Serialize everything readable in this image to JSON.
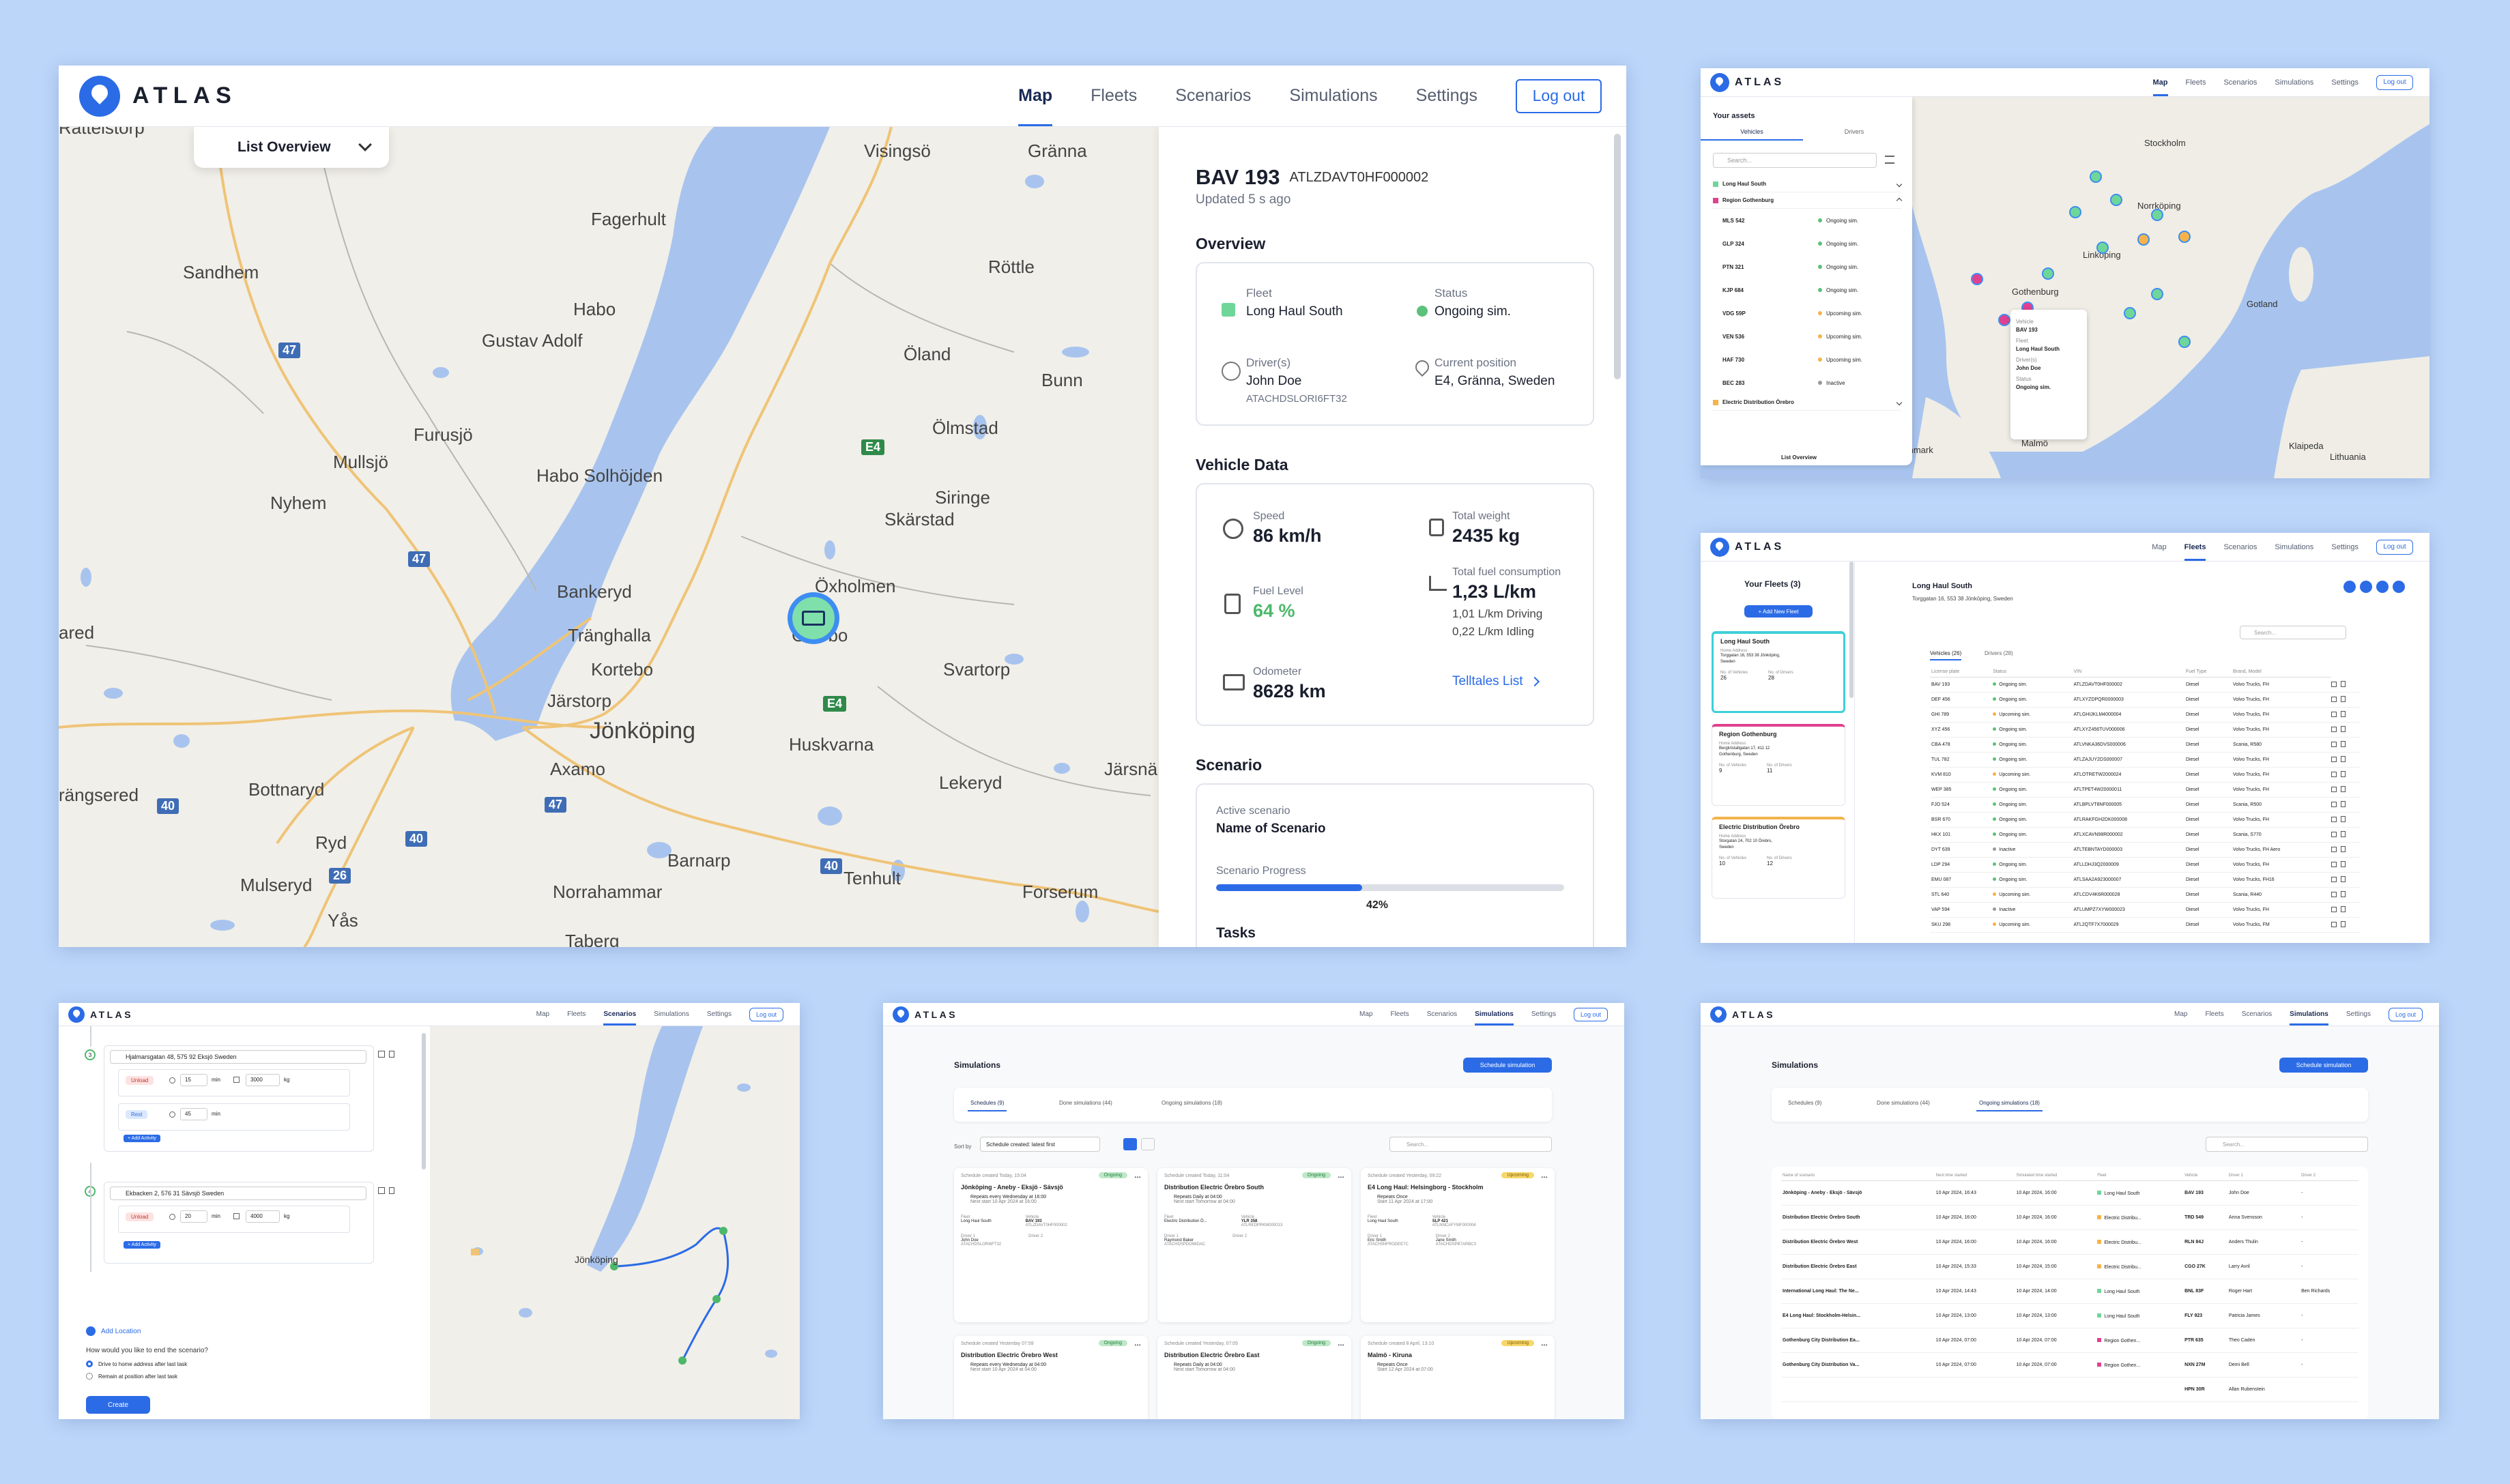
{
  "brand": "ATLAS",
  "nav": {
    "map": "Map",
    "fleets": "Fleets",
    "scenarios": "Scenarios",
    "simulations": "Simulations",
    "settings": "Settings",
    "logout": "Log out"
  },
  "colors": {
    "accent": "#2b6be6",
    "fleet_green": "#6fd69a",
    "fleet_pink": "#e0418f",
    "fleet_orange": "#f5b34a"
  },
  "main": {
    "list_overview": "List Overview",
    "places": [
      "Visingsö",
      "Gränna",
      "Fagerhult",
      "Röttle",
      "Sandhem",
      "Habo",
      "Gustav Adolf",
      "Öland",
      "Bunn",
      "Furusjö",
      "Ölmstad",
      "Mullsjö",
      "Habo Solhöjden",
      "Siringe",
      "Nyhem",
      "Skärstad",
      "Bankeryd",
      "Öxholmen",
      "Tränghalla",
      "Gisebo",
      "Kortebo",
      "Svartorp",
      "Järstorp",
      "Jönköping",
      "Huskvarna",
      "Axamo",
      "Lekeryd",
      "rängsered",
      "Bottnaryd",
      "Järsnä",
      "Ryd",
      "Mulseryd",
      "Barnarp",
      "Tenhult",
      "Norrahammar",
      "Forserum",
      "Yås",
      "Taberg",
      "Rattelstorp",
      "ared"
    ],
    "roads": [
      "47",
      "E4",
      "47",
      "E4",
      "40",
      "47",
      "40",
      "26",
      "40"
    ],
    "vehicle": {
      "title": "BAV 193",
      "vin": "ATLZDAVT0HF000002",
      "updated": "Updated 5 s ago"
    },
    "overview": {
      "heading": "Overview",
      "fleet_label": "Fleet",
      "fleet": "Long Haul South",
      "status_label": "Status",
      "status": "Ongoing sim.",
      "driver_label": "Driver(s)",
      "driver": "John Doe",
      "driver_id": "ATACHDSLORI6FT32",
      "pos_label": "Current position",
      "pos": "E4, Gränna, Sweden"
    },
    "vdata": {
      "heading": "Vehicle Data",
      "speed_label": "Speed",
      "speed": "86 km/h",
      "weight_label": "Total weight",
      "weight": "2435 kg",
      "fuel_label": "Fuel Level",
      "fuel": "64 %",
      "cons_label": "Total fuel consumption",
      "cons": "1,23 L/km",
      "cons_drive": "1,01 L/km Driving",
      "cons_idle": "0,22 L/km Idling",
      "odo_label": "Odometer",
      "odo": "8628 km",
      "telltales": "Telltales List"
    },
    "scenario": {
      "heading": "Scenario",
      "active_label": "Active scenario",
      "active": "Name of Scenario",
      "progress_label": "Scenario Progress",
      "progress": 0.42,
      "progress_text": "42%",
      "tasks": "Tasks"
    }
  },
  "assets": {
    "title": "Your assets",
    "tab_v": "Vehicles",
    "tab_d": "Drivers",
    "search": "Search...",
    "groups": [
      "Long Haul South",
      "Region Gothenburg",
      "Electric Distribution Örebro"
    ],
    "rows": [
      [
        "MLS 542",
        "Ongoing sim."
      ],
      [
        "GLP 324",
        "Ongoing sim."
      ],
      [
        "PTN 321",
        "Ongoing sim."
      ],
      [
        "KJP 684",
        "Ongoing sim."
      ],
      [
        "VDG 59P",
        "Upcoming sim."
      ],
      [
        "VEN 536",
        "Upcoming sim."
      ],
      [
        "HAF 730",
        "Upcoming sim."
      ],
      [
        "BEC 283",
        "Inactive"
      ]
    ],
    "popup": [
      "Vehicle",
      "BAV 193",
      "Fleet",
      "Long Haul South",
      "Driver(s)",
      "John Doe",
      "Status",
      "Ongoing sim."
    ],
    "map_places": [
      "Stockholm",
      "Norrköping",
      "Linköping",
      "Gothenburg",
      "Malmö",
      "Denmark",
      "Klaipeda",
      "Lithuania",
      "Gotland"
    ],
    "list_overview": "List Overview"
  },
  "fleets": {
    "title": "Your Fleets (3)",
    "add": "+ Add New Fleet",
    "cards": [
      {
        "name": "Long Haul South",
        "lbl": "Home Address",
        "addr": "Torggatan 16, 553 38 Jönköping, Sweden",
        "nv": "26",
        "nd": "28"
      },
      {
        "name": "Region Gothenburg",
        "lbl": "Home Address",
        "addr": "Bergkristallgatan 17, 411 12 Gothenburg, Sweden",
        "nv": "9",
        "nd": "11"
      },
      {
        "name": "Electric Distribution Örebro",
        "lbl": "Home Address",
        "addr": "Storgatan 24, 702 10 Örebro, Sweden",
        "nv": "10",
        "nd": "12"
      }
    ],
    "lbl_nv": "No. of Vehicles",
    "lbl_nd": "No. of Drivers",
    "detail_title": "Long Haul South",
    "detail_addr": "Torggatan 16, 553 38 Jönköping, Sweden",
    "tab_v": "Vehicles (26)",
    "tab_d": "Drivers (28)",
    "search": "Search...",
    "cols": [
      "License plate",
      "Status",
      "VIN",
      "Fuel Type",
      "Brand, Model"
    ],
    "rows": [
      [
        "BAV 193",
        "Ongoing sim.",
        "ATLZDAVT0HF000002",
        "Diesel",
        "Volvo Trucks, FH"
      ],
      [
        "DEF 456",
        "Ongoing sim.",
        "ATLXYZDPQR0000003",
        "Diesel",
        "Volvo Trucks, FH"
      ],
      [
        "GHI 789",
        "Upcoming sim.",
        "ATLGHIJKLM4000004",
        "Diesel",
        "Volvo Trucks, FH"
      ],
      [
        "XYZ 456",
        "Ongoing sim.",
        "ATLXYZ456TUV000006",
        "Diesel",
        "Volvo Trucks, FH"
      ],
      [
        "CBA 478",
        "Ongoing sim.",
        "ATLVNKA36DVS000006",
        "Diesel",
        "Scania, R580"
      ],
      [
        "TUL 782",
        "Ongoing sim.",
        "ATLZAJUY2DS000007",
        "Diesel",
        "Volvo Trucks, FH"
      ],
      [
        "KVM 810",
        "Upcoming sim.",
        "ATLOTRETW2000024",
        "Diesel",
        "Volvo Trucks, FH"
      ],
      [
        "WEP 385",
        "Ongoing sim.",
        "ATLTPET4W20000011",
        "Diesel",
        "Volvo Trucks, FH"
      ],
      [
        "FJO 524",
        "Ongoing sim.",
        "ATLBPLVT8NF000005",
        "Diesel",
        "Scania, R500"
      ],
      [
        "BSR 670",
        "Ongoing sim.",
        "ATLRAKFGH2DK000008",
        "Diesel",
        "Volvo Trucks, FH"
      ],
      [
        "HKX 101",
        "Ongoing sim.",
        "ATLXCAVN98R000002",
        "Diesel",
        "Scania, S770"
      ],
      [
        "DYT 639",
        "Inactive",
        "ATLTEBNTAYD000003",
        "Diesel",
        "Volvo Trucks, FH Aero"
      ],
      [
        "LDP 294",
        "Ongoing sim.",
        "ATLLDHJ3Q2000009",
        "Diesel",
        "Volvo Trucks, FH"
      ],
      [
        "EMU 087",
        "Ongoing sim.",
        "ATLSAA2A923000007",
        "Diesel",
        "Volvo Trucks, FH16"
      ],
      [
        "STL 640",
        "Upcoming sim.",
        "ATLCDV4K6R000028",
        "Diesel",
        "Scania, R440"
      ],
      [
        "VAP 594",
        "Inactive",
        "ATLUMPZ7XYW000023",
        "Diesel",
        "Volvo Trucks, FH"
      ],
      [
        "SKU 298",
        "Upcoming sim.",
        "ATL2QTF7X7000029",
        "Diesel",
        "Volvo Trucks, FM"
      ]
    ]
  },
  "scen": {
    "stops": [
      {
        "n": "3",
        "addr": "Hjalmarsgatan 48, 575 92 Eksjö Sweden",
        "a1": "Unload",
        "t1": "15",
        "k1": "3000",
        "a2": "Rest",
        "t2": "45"
      },
      {
        "n": "4",
        "addr": "Ekbacken 2, 576 31 Sävsjö Sweden",
        "a1": "Unload",
        "t1": "20",
        "k1": "4000"
      }
    ],
    "min": "min",
    "kg": "kg",
    "add_activity": "+ Add Activity",
    "add_location": "Add Location",
    "question": "How would you like to end the scenario?",
    "opt1": "Drive to home address after last task",
    "opt2": "Remain at position after last task",
    "create": "Create",
    "map_label": "Jönköping"
  },
  "sims1": {
    "title": "Simulations",
    "schedule": "Schedule simulation",
    "tabs": [
      "Schedules (9)",
      "Done simulations (44)",
      "Ongoing simulations (18)"
    ],
    "sort_label": "Sort by",
    "sort": "Schedule created: latest first",
    "search": "Search...",
    "cards": [
      {
        "created": "Schedule created Today, 15:04",
        "badge": "Ongoing",
        "title": "Jönköping - Aneby - Eksjö - Sävsjö",
        "repeat": "Repeats every Wednesday at 16:00",
        "next": "Next start 10 Apr 2024 at 16:00",
        "fleet": "Long Haul South",
        "vehicle": "BAV 193",
        "vin": "ATLZDAVT0HF000002",
        "driver": "John Doe",
        "did": "ATACHDSLORI6FT32"
      },
      {
        "created": "Schedule created Today, 11:04",
        "badge": "Ongoing",
        "title": "Distribution Electric Örebro South",
        "repeat": "Repeats Daily at 04:00",
        "next": "Next start Tomorrow at 04:00",
        "fleet": "Electric Distribution Ö...",
        "vehicle": "YLR 358",
        "vin": "ATLREDPRKM000013",
        "driver": "Raymond Baker",
        "did": "ATACHDSPDO98DAC"
      },
      {
        "created": "Schedule created Yesterday, 09:22",
        "badge": "Upcoming",
        "title": "E4 Long Haul: Helsingborg - Stockholm",
        "repeat": "Repeats Once",
        "next": "Start 11 Apr 2024 at 17:00",
        "fleet": "Long Haul South",
        "vehicle": "SLP 421",
        "vin": "ATLNNCAFYMF000004",
        "driver": "Eric Smith",
        "did": "ATACH5NFRODEE7C",
        "driver2": "Jane Smith",
        "did2": "ATACHDSPB7ARBC3"
      },
      {
        "created": "Schedule created Yesterday 07:59",
        "badge": "Ongoing",
        "title": "Distribution Electric Örebro West",
        "repeat": "Repeats every Wednesday at 04:00",
        "next": "Next start 10 Apr 2024 at 04:00"
      },
      {
        "created": "Schedule created Yesterday, 07:05",
        "badge": "Ongoing",
        "title": "Distribution Electric Örebro East",
        "repeat": "Repeats Daily at 04:00",
        "next": "Next start Tomorrow at 04:00"
      },
      {
        "created": "Schedule created 8 April, 13:10",
        "badge": "Upcoming",
        "title": "Malmö - Kiruna",
        "repeat": "Repeats Once",
        "next": "Start 12 Apr 2024 at 07:00"
      }
    ],
    "lbl_fleet": "Fleet",
    "lbl_vehicle": "Vehicle",
    "lbl_d1": "Driver 1",
    "lbl_d2": "Driver 2"
  },
  "sims2": {
    "title": "Simulations",
    "schedule": "Schedule simulation",
    "tabs": [
      "Schedules (9)",
      "Done simulations (44)",
      "Ongoing simulations (18)"
    ],
    "search": "Search...",
    "cols": [
      "Name of scenario",
      "Next time started",
      "Simulated time started",
      "Fleet",
      "Vehicle",
      "Driver 1",
      "Driver 2"
    ],
    "rows": [
      [
        "Jönköping - Aneby - Eksjö - Sävsjö",
        "10 Apr 2024, 16:43",
        "10 Apr 2024, 16:00",
        "Long Haul South",
        "BAV 193",
        "John Doe",
        "-"
      ],
      [
        "Distribution Electric Örebro South",
        "10 Apr 2024, 16:00",
        "10 Apr 2024, 16:00",
        "Electric Distribu...",
        "TRD 549",
        "Anna Svensson",
        "-"
      ],
      [
        "Distribution Electric Örebro West",
        "10 Apr 2024, 16:00",
        "10 Apr 2024, 16:00",
        "Electric Distribu...",
        "RLN 84J",
        "Anders Thulin",
        "-"
      ],
      [
        "Distribution Electric Örebro East",
        "10 Apr 2024, 15:33",
        "10 Apr 2024, 15:00",
        "Electric Distribu...",
        "CGO 27K",
        "Larry Avril",
        "-"
      ],
      [
        "International Long Haul: The Ne...",
        "10 Apr 2024, 14:43",
        "10 Apr 2024, 14:00",
        "Long Haul South",
        "BNL 83F",
        "Roger Hart",
        "Ben Richards"
      ],
      [
        "E4 Long Haul: Stockholm-Helsin...",
        "10 Apr 2024, 13:00",
        "10 Apr 2024, 13:00",
        "Long Haul South",
        "FLY 923",
        "Patricia James",
        "-"
      ],
      [
        "Gothenburg City Distribution Ea...",
        "10 Apr 2024, 07:00",
        "10 Apr 2024, 07:00",
        "Region Gothen...",
        "PTR 635",
        "Theo Caden",
        "-"
      ],
      [
        "Gothenburg City Distribution Va...",
        "10 Apr 2024, 07:00",
        "10 Apr 2024, 07:00",
        "Region Gothen...",
        "NXN 27M",
        "Demi Bell",
        "-"
      ],
      [
        "",
        "",
        "",
        "",
        "HPN 30R",
        "Allan Rubenstein",
        ""
      ]
    ],
    "fleetcolors": [
      "#6fd69a",
      "#f5b34a",
      "#f5b34a",
      "#f5b34a",
      "#6fd69a",
      "#6fd69a",
      "#e0418f",
      "#e0418f",
      "#6fd69a"
    ]
  }
}
